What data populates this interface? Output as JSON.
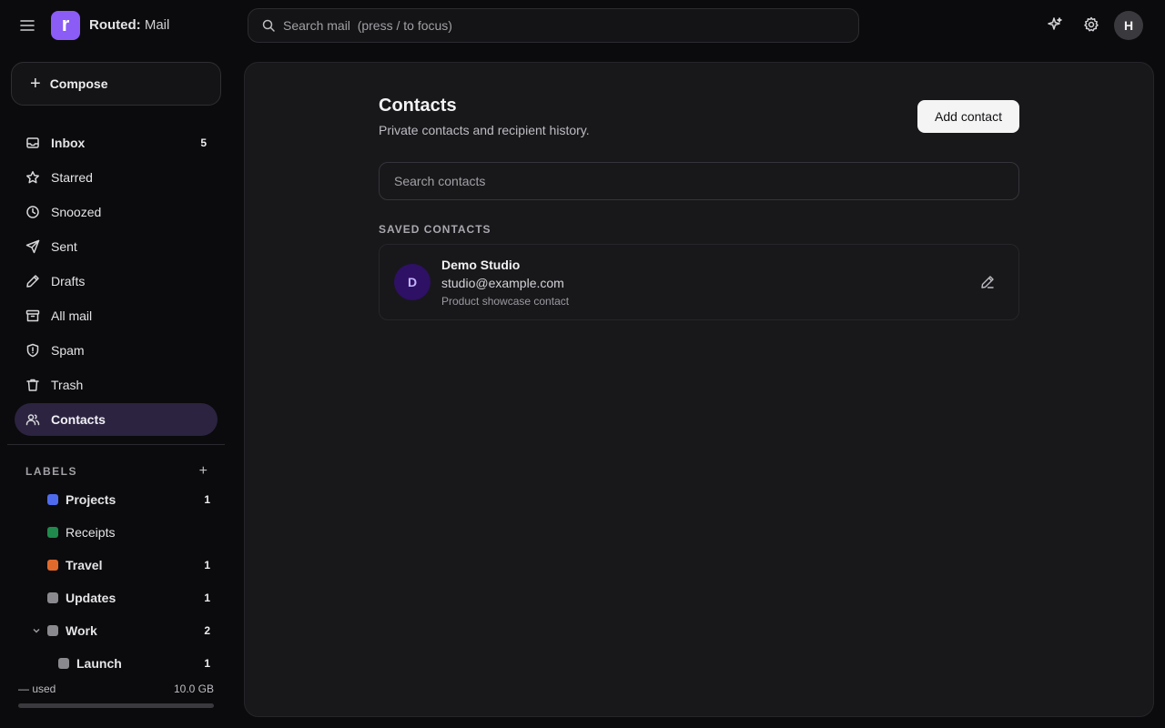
{
  "app": {
    "brand_name": "Routed:",
    "brand_sub": "Mail",
    "logo_letter": "r",
    "accent_color": "#8b5cf6"
  },
  "topbar": {
    "search_placeholder": "Search mail  (press / to focus)",
    "user_initial": "H",
    "icons": [
      "menu-icon",
      "search-icon",
      "sparkle-icon",
      "gear-icon"
    ]
  },
  "sidebar": {
    "compose_label": "Compose",
    "nav": [
      {
        "label": "Inbox",
        "count": "5",
        "icon": "inbox-icon"
      },
      {
        "label": "Starred",
        "count": "",
        "icon": "star-icon"
      },
      {
        "label": "Snoozed",
        "count": "",
        "icon": "clock-icon"
      },
      {
        "label": "Sent",
        "count": "",
        "icon": "send-icon"
      },
      {
        "label": "Drafts",
        "count": "",
        "icon": "pencil-icon"
      },
      {
        "label": "All mail",
        "count": "",
        "icon": "archive-icon"
      },
      {
        "label": "Spam",
        "count": "",
        "icon": "shield-icon"
      },
      {
        "label": "Trash",
        "count": "",
        "icon": "trash-icon"
      },
      {
        "label": "Contacts",
        "count": "",
        "icon": "users-icon",
        "active": true
      }
    ],
    "labels_title": "LABELS",
    "labels_add": "+",
    "labels": [
      {
        "name": "Projects",
        "count": "1",
        "color": "#4f6bed"
      },
      {
        "name": "Receipts",
        "count": "",
        "color": "#1f8a4c"
      },
      {
        "name": "Travel",
        "count": "1",
        "color": "#e06a2c"
      },
      {
        "name": "Updates",
        "count": "1",
        "color": "#8a8a8e"
      },
      {
        "name": "Work",
        "count": "2",
        "color": "#8a8a8e",
        "expanded": true
      },
      {
        "name": "Launch",
        "count": "1",
        "color": "#8a8a8e",
        "child": true
      }
    ],
    "storage": {
      "used": "— used",
      "total": "10.0 GB",
      "fraction": 0
    }
  },
  "main": {
    "title": "Contacts",
    "subtitle": "Private contacts and recipient history.",
    "add_button": "Add contact",
    "search_placeholder": "Search contacts",
    "section_label": "SAVED CONTACTS",
    "contacts": [
      {
        "initial": "D",
        "name": "Demo Studio",
        "email": "studio@example.com",
        "note": "Product showcase contact",
        "avatar_color": "#2e1065"
      }
    ]
  }
}
